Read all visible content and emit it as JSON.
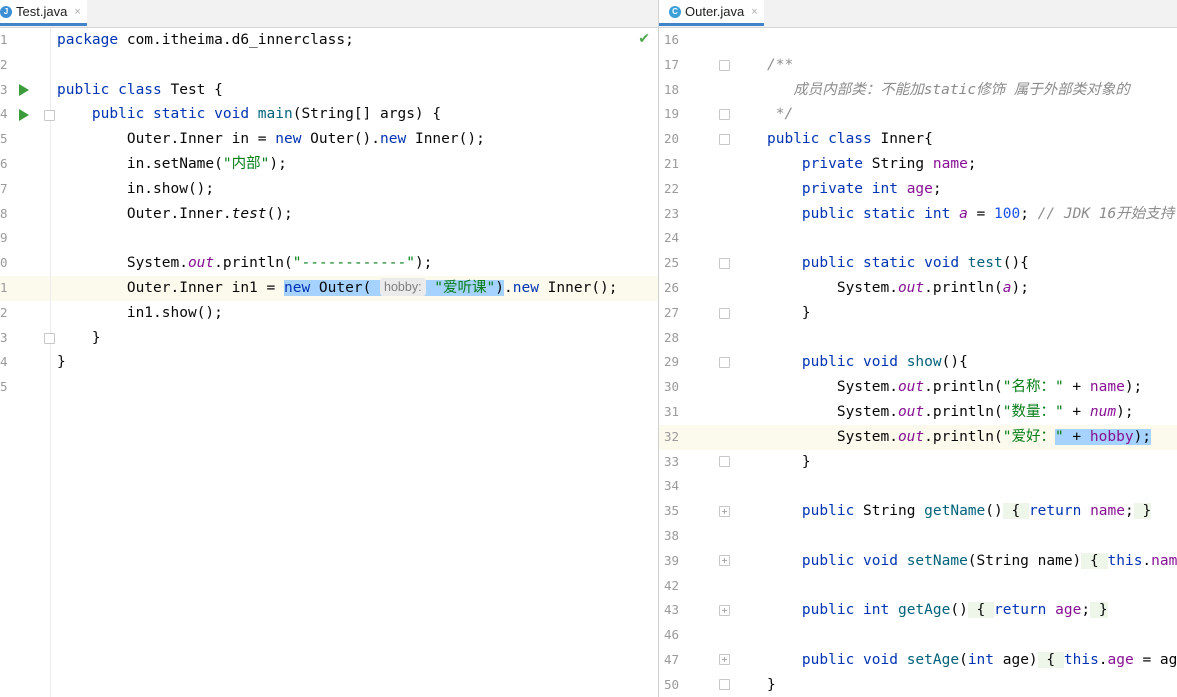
{
  "left": {
    "tab_label": "Test.java",
    "tab_close": "×",
    "line_numbers": [
      "1",
      "2",
      "3",
      "4",
      "5",
      "6",
      "7",
      "8",
      "9",
      "0",
      "1",
      "2",
      "3",
      "4",
      "5"
    ],
    "inlay_hint": "hobby:"
  },
  "right": {
    "tab_label": "Outer.java",
    "tab_close": "×",
    "line_numbers": [
      "16",
      "17",
      "18",
      "19",
      "20",
      "21",
      "22",
      "23",
      "24",
      "25",
      "26",
      "27",
      "28",
      "29",
      "30",
      "31",
      "32",
      "33",
      "34",
      "35",
      "38",
      "39",
      "42",
      "43",
      "46",
      "47",
      "50"
    ]
  },
  "icons": {
    "java_file_icon": "J",
    "class_file_icon": "C",
    "check_mark": "✔"
  },
  "colors": {
    "keyword": "#0033b3",
    "string": "#067d17",
    "field": "#871094",
    "number": "#1750eb",
    "selection": "#a6d2ff",
    "current_line": "#fcfaed",
    "run_icon": "#3b9c3b"
  }
}
